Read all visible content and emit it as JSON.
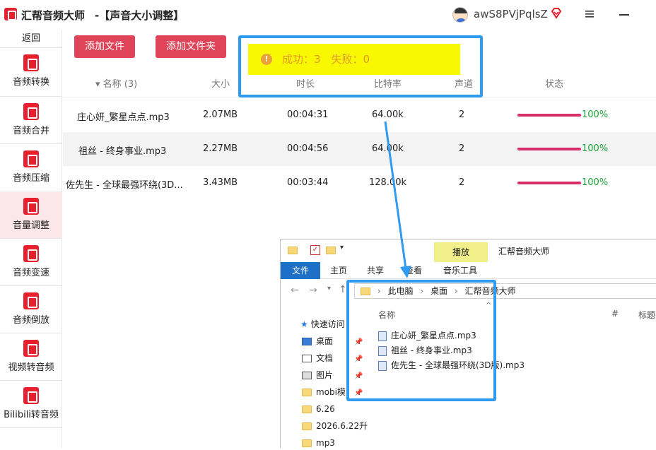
{
  "titlebar": {
    "app_name": "汇帮音频大师",
    "doc_title": "-【声音大小调整】",
    "username": "awS8PVjPqlsZ"
  },
  "sidebar": {
    "back_label": "返回",
    "items": [
      {
        "label": "音频转换",
        "icon": "audio-convert-icon"
      },
      {
        "label": "音频合并",
        "icon": "audio-merge-icon"
      },
      {
        "label": "音频压缩",
        "icon": "audio-compress-icon"
      },
      {
        "label": "音量调整",
        "icon": "volume-icon",
        "active": true
      },
      {
        "label": "音频变速",
        "icon": "microphone-icon"
      },
      {
        "label": "音频倒放",
        "icon": "music-note-icon"
      },
      {
        "label": "视频转音频",
        "icon": "film-icon"
      },
      {
        "label": "Bilibili转音频",
        "icon": "tv-icon"
      }
    ]
  },
  "toolbar": {
    "add_file": "添加文件",
    "add_folder": "添加文件夹"
  },
  "toast": {
    "text": "成功：3　失败：0"
  },
  "table": {
    "headers": {
      "name": "名称 (3)",
      "size": "大小",
      "duration": "时长",
      "bitrate": "比特率",
      "channels": "声道",
      "status": "状态"
    },
    "rows": [
      {
        "name": "庄心妍_繁星点点.mp3",
        "size": "2.07MB",
        "duration": "00:04:31",
        "bitrate": "64.00k",
        "channels": "2",
        "progress": 1.0,
        "pct": "100%"
      },
      {
        "name": "祖丝 - 终身事业.mp3",
        "size": "2.27MB",
        "duration": "00:04:56",
        "bitrate": "64.00k",
        "channels": "2",
        "progress": 1.0,
        "pct": "100%"
      },
      {
        "name": "佐先生 - 全球最强环绕(3D...",
        "size": "3.43MB",
        "duration": "00:03:44",
        "bitrate": "128.00k",
        "channels": "2",
        "progress": 1.0,
        "pct": "100%"
      }
    ]
  },
  "explorer": {
    "title": "汇帮音频大师",
    "play_tab": "播放",
    "tabs": [
      "文件",
      "主页",
      "共享",
      "查看",
      "音乐工具"
    ],
    "breadcrumb": [
      "此电脑",
      "桌面",
      "汇帮音频大师"
    ],
    "nav": [
      {
        "label": "快速访问",
        "type": "star"
      },
      {
        "label": "桌面",
        "type": "desktop"
      },
      {
        "label": "文档",
        "type": "doc"
      },
      {
        "label": "图片",
        "type": "pic"
      },
      {
        "label": "mobi模",
        "type": "folder"
      },
      {
        "label": "6.26",
        "type": "folder"
      },
      {
        "label": "2026.6.22升",
        "type": "folder"
      },
      {
        "label": "mp3",
        "type": "folder"
      }
    ],
    "columns": {
      "name": "名称",
      "num": "#",
      "title": "标题"
    },
    "files": [
      "庄心妍_繁星点点.mp3",
      "祖丝 - 终身事业.mp3",
      "佐先生 - 全球最强环绕(3D版).mp3"
    ]
  },
  "colors": {
    "brand_red": "#e8202e",
    "button": "#e04458",
    "progress": "#d62f6b",
    "success": "#1aa33a",
    "highlight": "#2f9bf0",
    "toast_bg": "#f8f800"
  }
}
